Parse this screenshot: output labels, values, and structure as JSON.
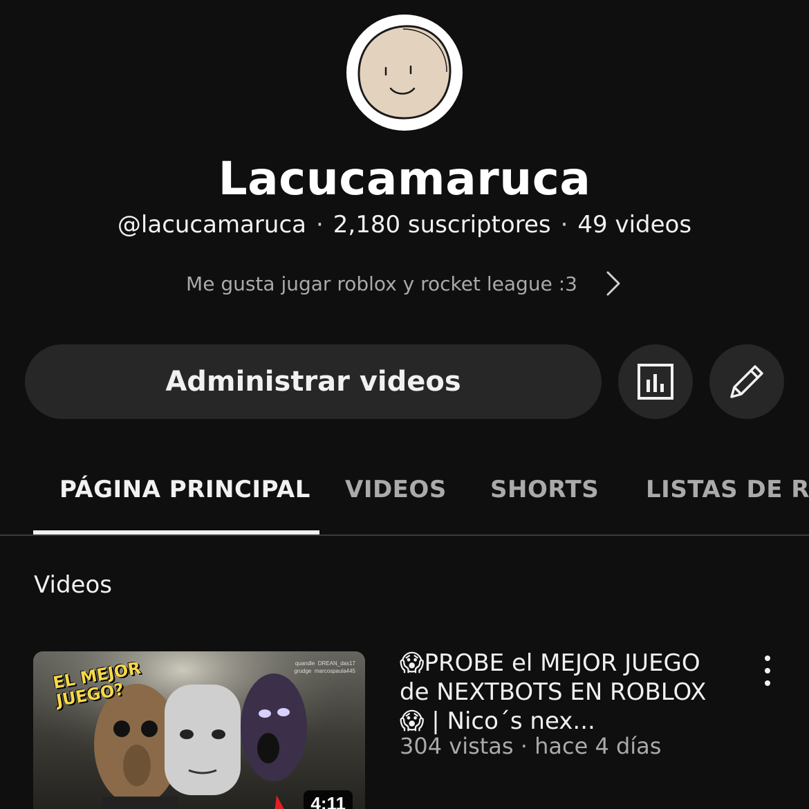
{
  "channel": {
    "name": "Lacucamaruca",
    "handle": "@lacucamaruca",
    "subscribers": "2,180 suscriptores",
    "video_count": "49 videos",
    "separator": "·",
    "description": "Me gusta jugar roblox y rocket league :3"
  },
  "actions": {
    "manage_label": "Administrar videos",
    "analytics_icon": "bar-chart-icon",
    "edit_icon": "pencil-icon"
  },
  "tabs": [
    {
      "label": "PÁGINA PRINCIPAL",
      "active": true
    },
    {
      "label": "VIDEOS",
      "active": false
    },
    {
      "label": "SHORTS",
      "active": false
    },
    {
      "label": "LISTAS DE RE",
      "active": false
    }
  ],
  "section": {
    "title": "Videos"
  },
  "video": {
    "title": "😱PROBE el MEJOR JUEGO de NEXTBOTS EN ROBLOX 😱 | Nico´s nex...",
    "meta": "304 vistas · hace 4 días",
    "duration": "4:11",
    "thumb_text": "EL MEJOR JUEGO?",
    "thumb_usernames": [
      "quandle",
      "DREAN_das17",
      "grudge",
      "marcospaula445"
    ]
  },
  "colors": {
    "background": "#0f0f0f",
    "button_bg": "#272727",
    "text_primary": "#f1f1f1",
    "text_secondary": "#aaaaaa",
    "thumb_text": "#f7d84a"
  }
}
